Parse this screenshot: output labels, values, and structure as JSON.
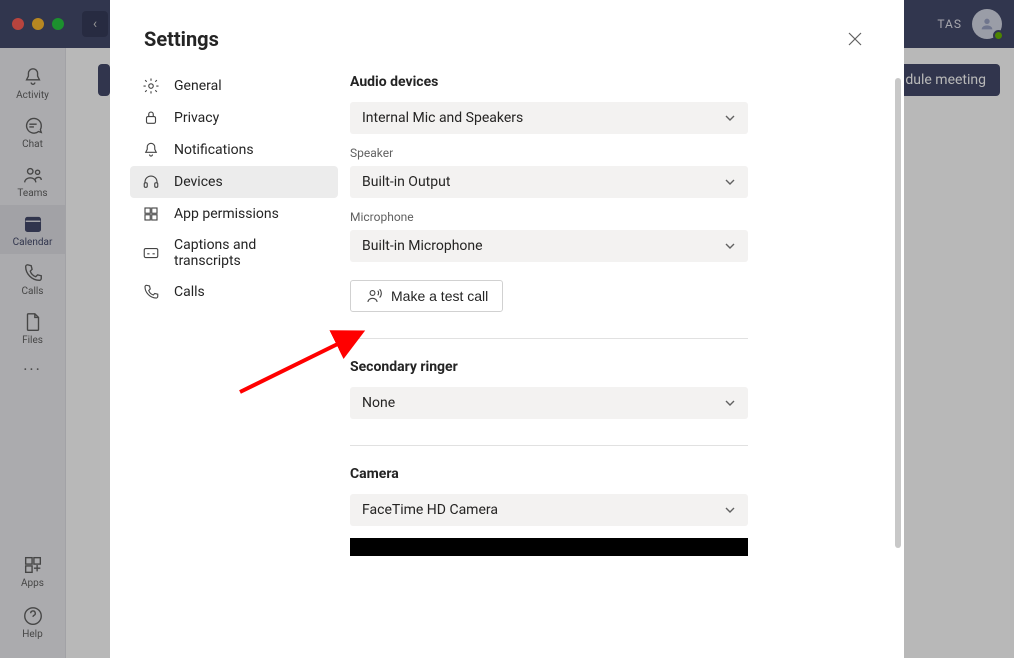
{
  "topbar": {
    "user_initials": "TAS",
    "back_glyph": "‹"
  },
  "sidebar": {
    "items": [
      {
        "label": "Activity"
      },
      {
        "label": "Chat"
      },
      {
        "label": "Teams"
      },
      {
        "label": "Calendar"
      },
      {
        "label": "Calls"
      },
      {
        "label": "Files"
      }
    ],
    "more": "···",
    "apps": "Apps",
    "help": "Help"
  },
  "content": {
    "schedule_btn": "dule meeting"
  },
  "settings": {
    "title": "Settings",
    "categories": [
      {
        "label": "General"
      },
      {
        "label": "Privacy"
      },
      {
        "label": "Notifications"
      },
      {
        "label": "Devices"
      },
      {
        "label": "App permissions"
      },
      {
        "label": "Captions and transcripts"
      },
      {
        "label": "Calls"
      }
    ]
  },
  "devices": {
    "audio": {
      "section": "Audio devices",
      "device_select": "Internal Mic and Speakers",
      "speaker_label": "Speaker",
      "speaker_select": "Built-in Output",
      "mic_label": "Microphone",
      "mic_select": "Built-in Microphone",
      "test_call_btn": "Make a test call"
    },
    "ringer": {
      "section": "Secondary ringer",
      "select": "None"
    },
    "camera": {
      "section": "Camera",
      "select": "FaceTime HD Camera"
    }
  }
}
